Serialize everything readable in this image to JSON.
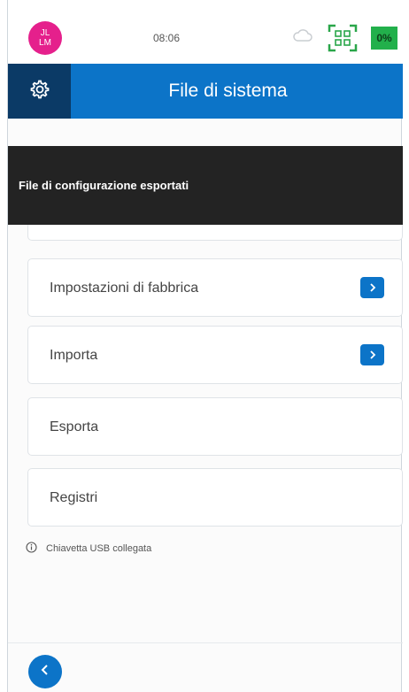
{
  "status": {
    "avatar_line1": "JL",
    "avatar_line2": "LM",
    "time": "08:06",
    "battery": "0%"
  },
  "header": {
    "title": "File di sistema"
  },
  "toast": {
    "message": "File di configurazione esportati"
  },
  "menu": [
    {
      "label": "Impostazioni di fabbrica",
      "has_chevron": true
    },
    {
      "label": "Importa",
      "has_chevron": true
    },
    {
      "label": "Esporta",
      "has_chevron": false
    },
    {
      "label": "Registri",
      "has_chevron": false
    }
  ],
  "usb_status": "Chiavetta USB collegata",
  "colors": {
    "primary": "#0c74c8",
    "header_dark": "#0b3a66",
    "avatar": "#e5208c",
    "battery": "#22b04b",
    "toast": "#232323"
  },
  "icons": [
    "gear-icon",
    "cloud-icon",
    "qr-scan-icon",
    "chevron-right-icon",
    "info-icon",
    "chevron-left-icon"
  ]
}
